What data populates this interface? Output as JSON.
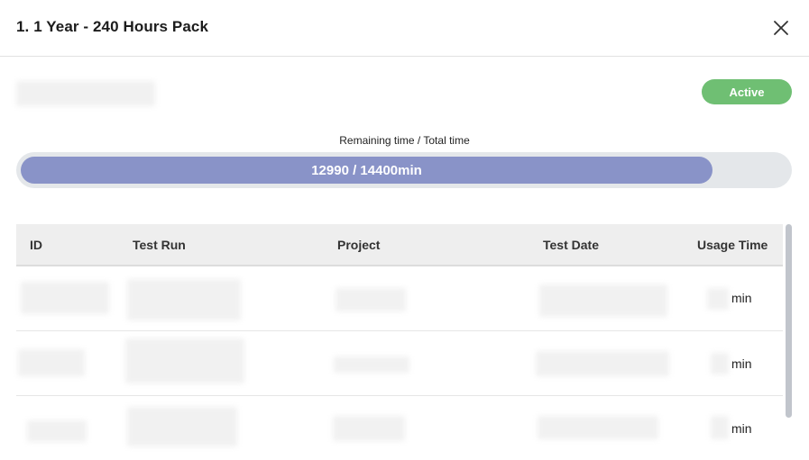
{
  "modal": {
    "title": "1. 1 Year - 240 Hours Pack",
    "close_icon": "close-icon"
  },
  "status": {
    "label": "Active",
    "color": "#6fbf73"
  },
  "usage": {
    "caption": "Remaining time / Total time",
    "display": "12990 / 14400min",
    "remaining": 12990,
    "total": 14400,
    "fill_color": "#8993c8"
  },
  "table": {
    "columns": [
      "ID",
      "Test Run",
      "Project",
      "Test Date",
      "Usage Time"
    ],
    "rows": [
      {
        "usage_unit": "min"
      },
      {
        "usage_unit": "min"
      },
      {
        "usage_unit": "min"
      }
    ]
  }
}
